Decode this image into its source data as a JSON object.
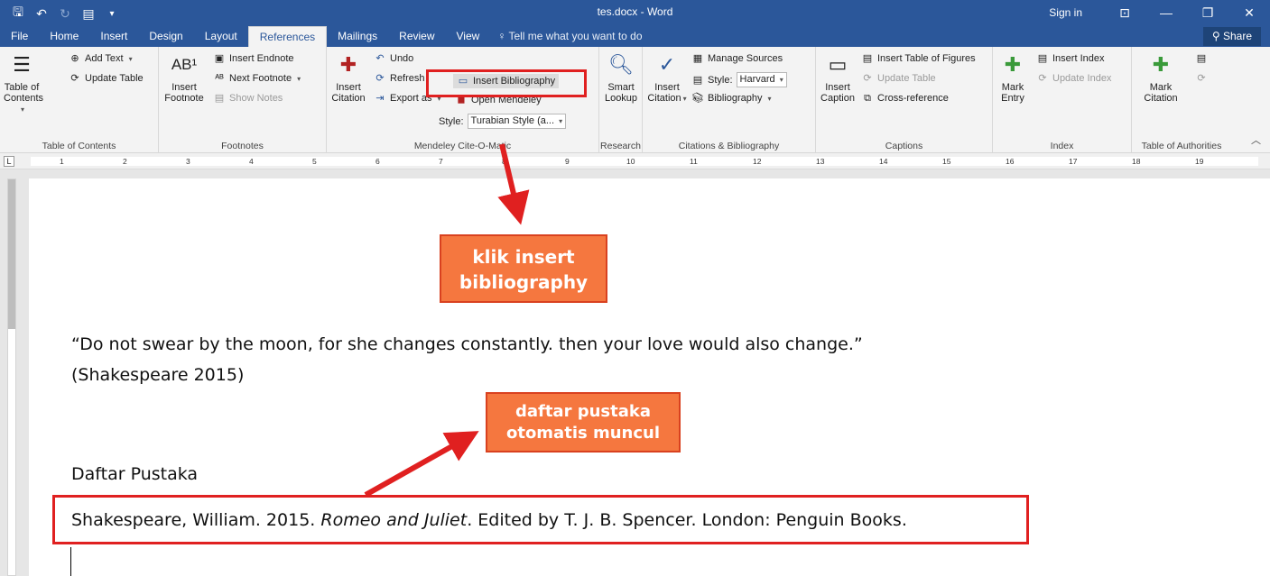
{
  "window": {
    "title": "tes.docx - Word",
    "sign_in": "Sign in",
    "share": "Share",
    "tell_me": "Tell me what you want to do"
  },
  "tabs": [
    "File",
    "Home",
    "Insert",
    "Design",
    "Layout",
    "References",
    "Mailings",
    "Review",
    "View"
  ],
  "active_tab": "References",
  "ribbon": {
    "toc": {
      "big_label_1": "Table of",
      "big_label_2": "Contents",
      "add_text": "Add Text",
      "update_table": "Update Table",
      "group": "Table of Contents"
    },
    "footnotes": {
      "insert_footnote_1": "Insert",
      "insert_footnote_2": "Footnote",
      "insert_endnote": "Insert Endnote",
      "next_footnote": "Next Footnote",
      "show_notes": "Show Notes",
      "group": "Footnotes"
    },
    "mendeley": {
      "insert_citation_1": "Insert",
      "insert_citation_2": "Citation",
      "undo": "Undo",
      "refresh": "Refresh",
      "export_as": "Export as",
      "insert_bibliography": "Insert Bibliography",
      "open_mendeley": "Open Mendeley",
      "style_label": "Style:",
      "style_value": "Turabian Style (a...",
      "group": "Mendeley Cite-O-Matic"
    },
    "research": {
      "smart_lookup_1": "Smart",
      "smart_lookup_2": "Lookup",
      "group": "Research"
    },
    "citations": {
      "insert_citation_1": "Insert",
      "insert_citation_2": "Citation",
      "manage_sources": "Manage Sources",
      "style_label": "Style:",
      "style_value": "Harvard",
      "bibliography": "Bibliography",
      "group": "Citations & Bibliography"
    },
    "captions": {
      "insert_caption_1": "Insert",
      "insert_caption_2": "Caption",
      "insert_table_of_figures": "Insert Table of Figures",
      "update_table": "Update Table",
      "cross_reference": "Cross-reference",
      "group": "Captions"
    },
    "index": {
      "mark_entry_1": "Mark",
      "mark_entry_2": "Entry",
      "insert_index": "Insert Index",
      "update_index": "Update Index",
      "group": "Index"
    },
    "authorities": {
      "mark_citation_1": "Mark",
      "mark_citation_2": "Citation",
      "group": "Table of Authorities"
    }
  },
  "ruler_numbers": [
    "1",
    "2",
    "3",
    "4",
    "5",
    "6",
    "7",
    "8",
    "9",
    "10",
    "11",
    "12",
    "13",
    "14",
    "15",
    "16",
    "17",
    "18",
    "19"
  ],
  "document": {
    "quote_line1": "“Do not swear by the moon, for she changes constantly. then your love would also change.”",
    "quote_line2": "(Shakespeare 2015)",
    "heading": "Daftar Pustaka",
    "bib_prefix": "Shakespeare, William. 2015. ",
    "bib_title": "Romeo and Juliet",
    "bib_suffix": ". Edited by  T. J. B. Spencer. London: Penguin Books."
  },
  "annotations": {
    "callout1_line1": "klik insert",
    "callout1_line2": "bibliography",
    "callout2_line1": "daftar pustaka",
    "callout2_line2": "otomatis muncul",
    "highlight_color": "#e02020",
    "callout_color": "#f5773f"
  },
  "colors": {
    "title_bar": "#2b579a",
    "ribbon": "#f3f3f3"
  }
}
